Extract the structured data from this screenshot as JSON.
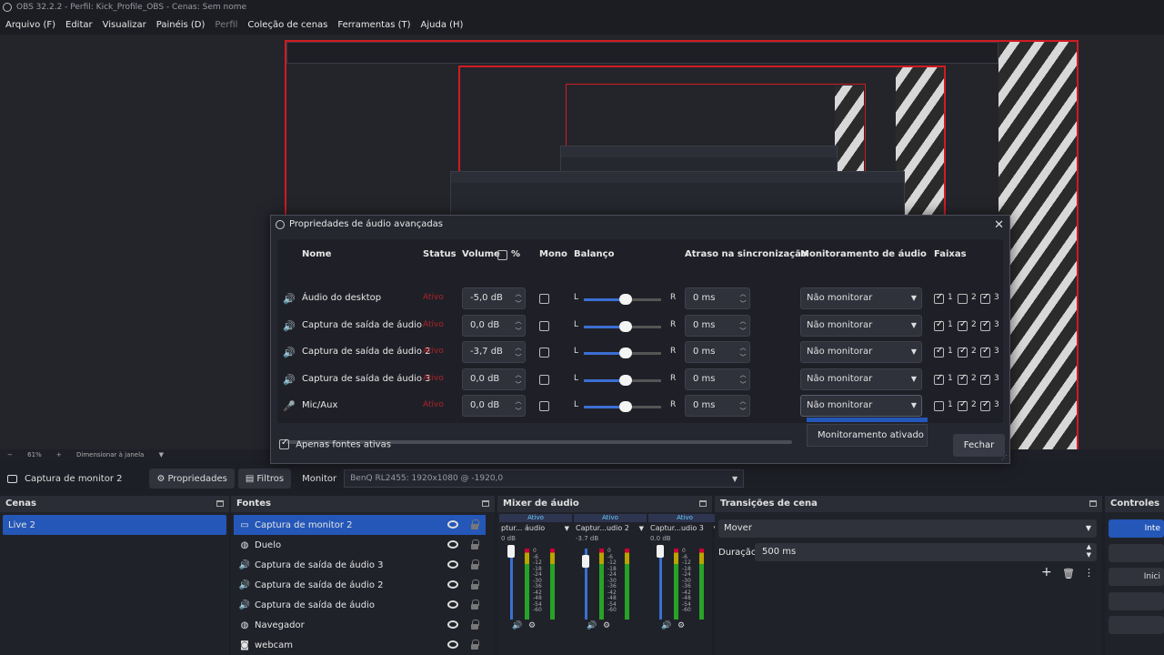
{
  "window": {
    "title": "OBS 32.2.2 - Perfil: Kick_Profile_OBS - Cenas: Sem nome"
  },
  "menu": [
    "Arquivo (F)",
    "Editar",
    "Visualizar",
    "Painéis (D)",
    "Perfil",
    "Coleção de cenas",
    "Ferramentas (T)",
    "Ajuda (H)"
  ],
  "status_row": {
    "zoom_minus": "−",
    "zoom": "61%",
    "zoom_plus": "+",
    "scale_mode": "Dimensionar à janela"
  },
  "source_bar": {
    "source_name": "Captura de monitor 2",
    "properties_label": "Propriedades",
    "filters_label": "Filtros",
    "monitor_label": "Monitor",
    "monitor_value": "BenQ RL2455: 1920x1080 @ -1920,0"
  },
  "docks": {
    "scenes": {
      "title": "Cenas",
      "items": [
        "Live 2"
      ]
    },
    "sources": {
      "title": "Fontes",
      "items": [
        {
          "label": "Captura de monitor 2",
          "icon": "monitor-icon"
        },
        {
          "label": "Duelo",
          "icon": "globe-icon"
        },
        {
          "label": "Captura de saída de áudio 3",
          "icon": "speaker-icon"
        },
        {
          "label": "Captura de saída de áudio 2",
          "icon": "speaker-icon"
        },
        {
          "label": "Captura de saída de áudio",
          "icon": "speaker-icon"
        },
        {
          "label": "Navegador",
          "icon": "globe-icon"
        },
        {
          "label": "webcam",
          "icon": "camera-icon"
        }
      ]
    },
    "mixer": {
      "title": "Mixer de áudio",
      "channels": [
        {
          "status": "Ativo",
          "name": "ptur... áudio",
          "db": "0 dB",
          "level": 1.0
        },
        {
          "status": "Ativo",
          "name": "Captur...udio 2",
          "db": "-3.7 dB",
          "level": 0.86
        },
        {
          "status": "Ativo",
          "name": "Captur...udio 3",
          "db": "0.0 dB",
          "level": 1.0
        }
      ],
      "scale": [
        "0",
        "-6",
        "-12",
        "-18",
        "-24",
        "-30",
        "-36",
        "-42",
        "-48",
        "-54",
        "-60"
      ]
    },
    "transitions": {
      "title": "Transições de cena",
      "transition": "Mover",
      "duration_label": "Duração",
      "duration": "500 ms"
    },
    "controls": {
      "title": "Controles",
      "buttons": [
        "Inte",
        "",
        "Inici",
        "",
        ""
      ]
    }
  },
  "dialog": {
    "title": "Propriedades de áudio avançadas",
    "headers": {
      "name": "Nome",
      "status": "Status",
      "volume": "Volume",
      "percent": "%",
      "mono": "Mono",
      "balance": "Balanço",
      "sync": "Atraso na sincronização",
      "monitoring": "Monitoramento de áudio",
      "tracks": "Faixas"
    },
    "balance_l": "L",
    "balance_r": "R",
    "rows": [
      {
        "icon": "speaker-icon",
        "name": "Áudio do desktop",
        "status": "Ativo",
        "volume": "-5,0 dB",
        "mono": false,
        "balance": 0.5,
        "sync": "0 ms",
        "monitoring": "Não monitorar",
        "tracks": [
          true,
          false,
          true
        ]
      },
      {
        "icon": "speaker-icon",
        "name": "Captura de saída de áudio",
        "status": "Ativo",
        "volume": "0,0 dB",
        "mono": false,
        "balance": 0.5,
        "sync": "0 ms",
        "monitoring": "Não monitorar",
        "tracks": [
          true,
          true,
          true
        ]
      },
      {
        "icon": "speaker-icon",
        "name": "Captura de saída de áudio 2",
        "status": "Ativo",
        "volume": "-3,7 dB",
        "mono": false,
        "balance": 0.5,
        "sync": "0 ms",
        "monitoring": "Não monitorar",
        "tracks": [
          true,
          true,
          true
        ]
      },
      {
        "icon": "speaker-icon",
        "name": "Captura de saída de áudio 3",
        "status": "Ativo",
        "volume": "0,0 dB",
        "mono": false,
        "balance": 0.5,
        "sync": "0 ms",
        "monitoring": "Não monitorar",
        "tracks": [
          true,
          true,
          true
        ]
      },
      {
        "icon": "microphone-icon",
        "name": "Mic/Aux",
        "status": "Ativo",
        "volume": "0,0 dB",
        "mono": false,
        "balance": 0.5,
        "sync": "0 ms",
        "monitoring": "Não monitorar",
        "tracks": [
          false,
          true,
          true
        ]
      }
    ],
    "track_labels": [
      "1",
      "2",
      "3"
    ],
    "dropdown_option": "Monitoramento ativado",
    "only_active_label": "Apenas fontes ativas",
    "close_label": "Fechar"
  }
}
